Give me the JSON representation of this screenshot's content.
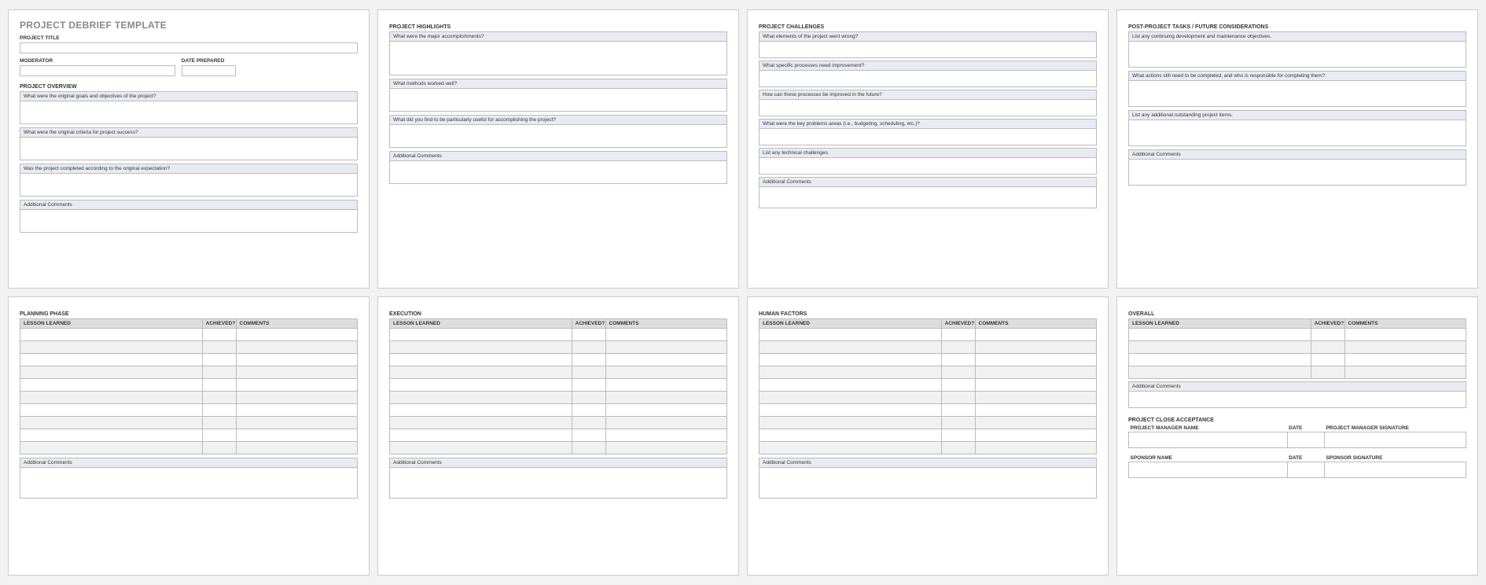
{
  "doc_title": "PROJECT DEBRIEF TEMPLATE",
  "labels": {
    "project_title": "PROJECT TITLE",
    "moderator": "MODERATOR",
    "date_prepared": "DATE PREPARED",
    "additional_comments": "Additional Comments"
  },
  "sections": {
    "overview": {
      "title": "PROJECT OVERVIEW",
      "q1": "What were the original goals and objectives of the project?",
      "q2": "What were the original criteria for project success?",
      "q3": "Was the project completed according to the original expectation?"
    },
    "highlights": {
      "title": "PROJECT HIGHLIGHTS",
      "q1": "What were the major accomplishments?",
      "q2": "What methods worked well?",
      "q3": "What did you find to be particularly useful for accomplishing the project?"
    },
    "challenges": {
      "title": "PROJECT CHALLENGES",
      "q1": "What elements of the project went wrong?",
      "q2": "What specific processes need improvement?",
      "q3": "How can these processes be improved in the future?",
      "q4": "What were the key problems areas (i.e., budgeting, scheduling, etc.)?",
      "q5": "List any technical challenges."
    },
    "post": {
      "title": "POST-PROJECT TASKS / FUTURE CONSIDERATIONS",
      "q1": "List any continuing development and maintenance objectives.",
      "q2": "What actions still need to be completed, and who is responsible for completing them?",
      "q3": "List any additional outstanding project items."
    },
    "planning": {
      "title": "PLANNING PHASE"
    },
    "execution": {
      "title": "EXECUTION"
    },
    "human": {
      "title": "HUMAN FACTORS"
    },
    "overall": {
      "title": "OVERALL"
    },
    "acceptance": {
      "title": "PROJECT CLOSE ACCEPTANCE",
      "pm_name": "PROJECT MANAGER NAME",
      "pm_sig": "PROJECT MANAGER SIGNATURE",
      "sp_name": "SPONSOR NAME",
      "sp_sig": "SPONSOR SIGNATURE",
      "date": "DATE"
    }
  },
  "lessons_headers": {
    "lesson": "LESSON LEARNED",
    "achieved": "ACHIEVED?",
    "comments": "COMMENTS"
  }
}
